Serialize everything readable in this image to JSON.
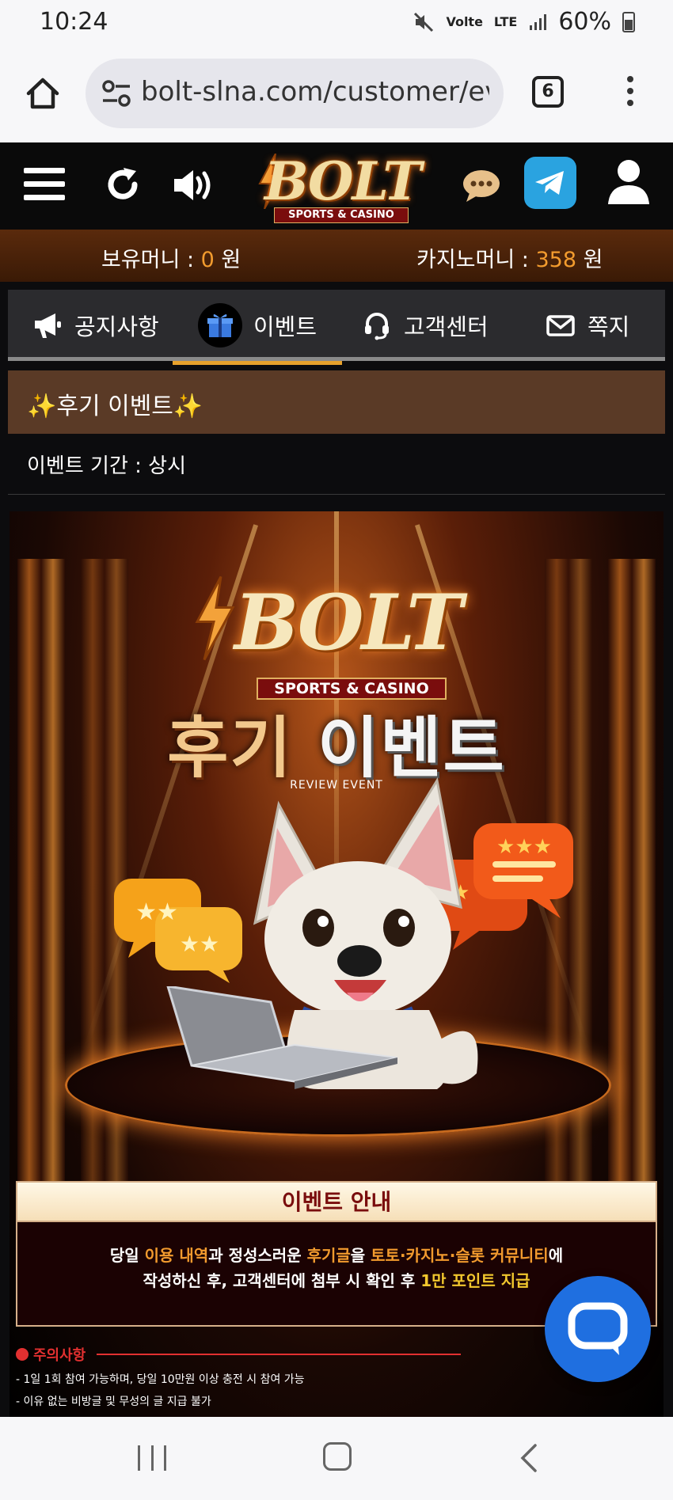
{
  "status_bar": {
    "time": "10:24",
    "network_label": "Volte",
    "lte_label": "LTE",
    "battery": "60%"
  },
  "browser": {
    "url": "bolt-slna.com/customer/ev_",
    "tab_count": "6"
  },
  "site": {
    "brand": "BOLT",
    "brand_tagline": "SPORTS & CASINO"
  },
  "money": {
    "holding_label": "보유머니 : ",
    "holding_value": "0",
    "holding_unit": " 원",
    "casino_label": "카지노머니 : ",
    "casino_value": "358",
    "casino_unit": " 원"
  },
  "tabs": [
    {
      "label": "공지사항",
      "icon": "megaphone-icon",
      "active": false
    },
    {
      "label": "이벤트",
      "icon": "gift-icon",
      "active": true
    },
    {
      "label": "고객센터",
      "icon": "headset-icon",
      "active": false
    },
    {
      "label": "쪽지",
      "icon": "mail-icon",
      "active": false
    }
  ],
  "event": {
    "title": "✨후기 이벤트✨",
    "period": "이벤트 기간 : 상시"
  },
  "banner": {
    "brand": "BOLT",
    "brand_tagline": "SPORTS & CASINO",
    "headline_a": "후기 ",
    "headline_b": "이벤트",
    "subheadline": "REVIEW EVENT",
    "notice_title": "이벤트 안내",
    "notice_line1": [
      "당일 ",
      "이용 내역",
      "과 정성스러운 ",
      "후기글",
      "을 ",
      "토토·카지노·슬롯 커뮤니티",
      "에"
    ],
    "notice_line2": [
      "작성하신 후, 고객센터에 첨부 시 확인 후 ",
      "1만 포인트 지급"
    ],
    "caution_title": "주의사항",
    "caution_items": [
      "- 1일 1회 참여 가능하며, 당일 10만원 이상 충전 시 참여 가능",
      "- 이유 없는 비방글 및 무성의 글 지급 불가"
    ]
  },
  "colors": {
    "accent": "#e8a22c",
    "money_value": "#f29b2e",
    "fab": "#1f6fe0",
    "telegram": "#2aa3e0"
  }
}
